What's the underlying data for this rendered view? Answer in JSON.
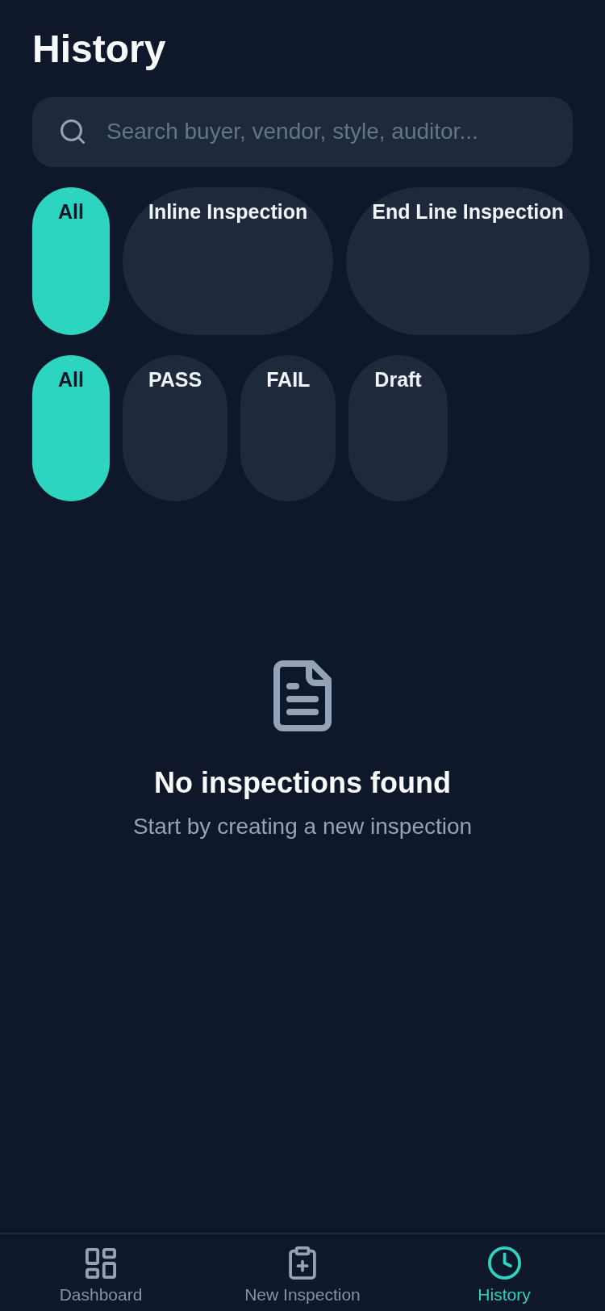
{
  "header": {
    "title": "History"
  },
  "search": {
    "placeholder": "Search buyer, vendor, style, auditor..."
  },
  "type_filters": [
    {
      "label": "All",
      "selected": true
    },
    {
      "label": "Inline Inspection",
      "selected": false
    },
    {
      "label": "End Line Inspection",
      "selected": false
    }
  ],
  "status_filters": [
    {
      "label": "All",
      "selected": true
    },
    {
      "label": "PASS",
      "selected": false
    },
    {
      "label": "FAIL",
      "selected": false
    },
    {
      "label": "Draft",
      "selected": false
    }
  ],
  "empty_state": {
    "title": "No inspections found",
    "message": "Start by creating a new inspection"
  },
  "bottom_nav": [
    {
      "label": "Dashboard",
      "selected": false
    },
    {
      "label": "New Inspection",
      "selected": false
    },
    {
      "label": "History",
      "selected": true
    }
  ]
}
